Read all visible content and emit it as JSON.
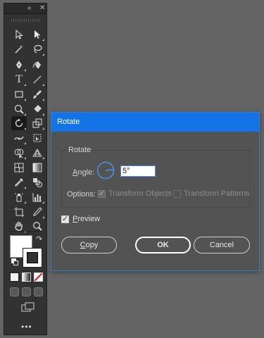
{
  "toolbar": {
    "collapse_glyph": "«",
    "close_glyph": "✕",
    "more_glyph": "•••"
  },
  "dialog": {
    "title": "Rotate",
    "group_label": "Rotate",
    "angle_label": "Angle:",
    "angle_value": "5°",
    "options_label": "Options:",
    "transform_objects_label": "Transform Objects",
    "transform_objects_checked": true,
    "transform_patterns_label": "Transform Patterns",
    "transform_patterns_checked": false,
    "preview_label": "Preview",
    "preview_checked": true,
    "copy_label": "Copy",
    "ok_label": "OK",
    "cancel_label": "Cancel"
  },
  "colors": {
    "title_bar": "#1473e6",
    "dialog_bg": "#535353",
    "panel_bg": "#323232",
    "desktop_bg": "#646464"
  }
}
